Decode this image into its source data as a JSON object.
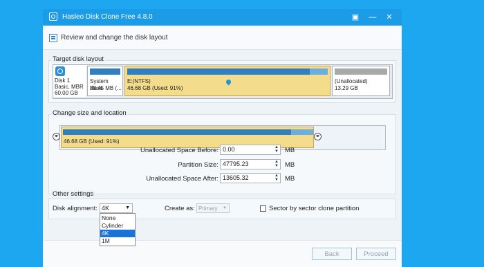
{
  "window": {
    "title": "Hasleo Disk Clone Free 4.8.0",
    "controls": {
      "restore": "▣",
      "minimize": "—",
      "close": "✕"
    }
  },
  "step": {
    "title": "Review and change the disk layout"
  },
  "target_layout": {
    "label": "Target disk layout",
    "disk": {
      "name": "Disk 1",
      "type": "Basic, MBR",
      "size": "60.00 GB"
    },
    "partitions": [
      {
        "label": "System Rese",
        "info": "38.45 MB (...",
        "selected": false,
        "bar_color": "#2f7fc1"
      },
      {
        "label": "E:(NTFS)",
        "info": "46.68 GB (Used: 91%)",
        "selected": true,
        "bar_color": "#2f7fc1"
      },
      {
        "label": "(Unallocated)",
        "info": "13.29 GB",
        "selected": false,
        "bar_color": "#a9a9a9"
      }
    ]
  },
  "resize": {
    "label": "Change size and location",
    "partition_text": "46.68 GB (Used: 91%)",
    "used_fraction": 0.91,
    "fields": [
      {
        "label": "Unallocated Space Before:",
        "value": "0.00",
        "unit": "MB"
      },
      {
        "label": "Partition Size:",
        "value": "47795.23",
        "unit": "MB"
      },
      {
        "label": "Unallocated Space After:",
        "value": "13605.32",
        "unit": "MB"
      }
    ]
  },
  "other": {
    "label": "Other settings",
    "alignment_label": "Disk alignment:",
    "alignment_value": "4K",
    "alignment_options": [
      "None",
      "Cylinder",
      "4K",
      "1M"
    ],
    "alignment_selected_index": 2,
    "create_as_label": "Create as:",
    "create_as_value": "Primary",
    "sector_label": "Sector by sector clone partition",
    "sector_checked": false
  },
  "buttons": {
    "back": "Back",
    "proceed": "Proceed"
  },
  "colors": {
    "accent": "#1c9be6",
    "selected_partition": "#f3dc8c",
    "selection": "#1a73d9"
  }
}
